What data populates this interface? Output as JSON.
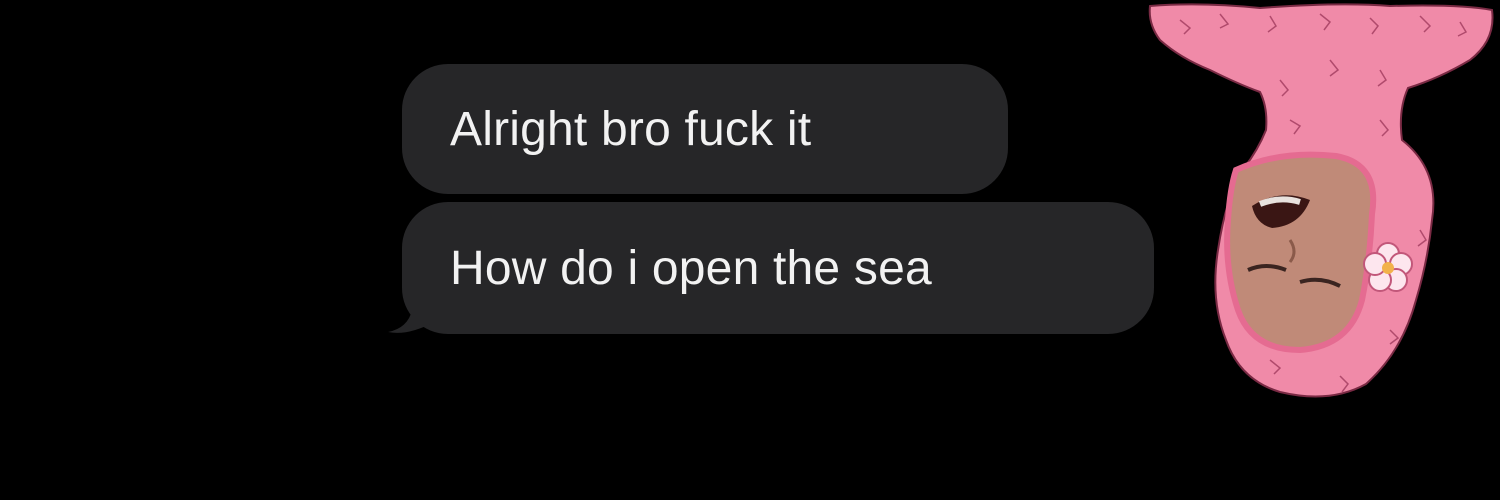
{
  "conversation": {
    "messages": [
      {
        "text": "Alright bro fuck it"
      },
      {
        "text": "How do i open the sea"
      }
    ]
  },
  "sticker": {
    "icon": "upside-down-pink-fluffy-hood-sticker-icon",
    "flower_icon": "flower-icon"
  },
  "colors": {
    "background": "#000000",
    "bubble": "#262628",
    "text": "#f2f2f2",
    "hood_pink": "#f08aa8"
  }
}
